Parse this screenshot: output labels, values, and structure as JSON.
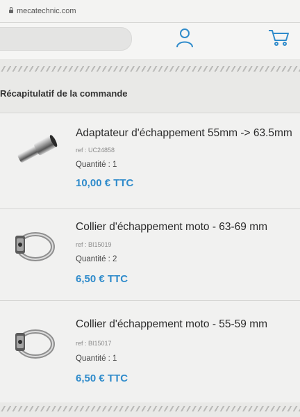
{
  "browser": {
    "url": "mecatechnic.com"
  },
  "icons": {
    "account": "user-icon",
    "cart": "cart-icon",
    "lock": "lock-icon"
  },
  "colors": {
    "accent": "#2f8bcb",
    "price": "#2f8bcb"
  },
  "page": {
    "title": "Récapitulatif de la commande"
  },
  "items": [
    {
      "name": "Adaptateur d'échappement 55mm -> 63.5mm",
      "ref": "ref : UC24858",
      "quantity": "Quantité : 1",
      "price": "10,00 € TTC",
      "image": "exhaust-adapter-image"
    },
    {
      "name": "Collier d'échappement moto - 63-69 mm",
      "ref": "ref : BI15019",
      "quantity": "Quantité : 2",
      "price": "6,50 € TTC",
      "image": "exhaust-clamp-image"
    },
    {
      "name": "Collier d'échappement moto - 55-59 mm",
      "ref": "ref : BI15017",
      "quantity": "Quantité : 1",
      "price": "6,50 € TTC",
      "image": "exhaust-clamp-image"
    }
  ]
}
